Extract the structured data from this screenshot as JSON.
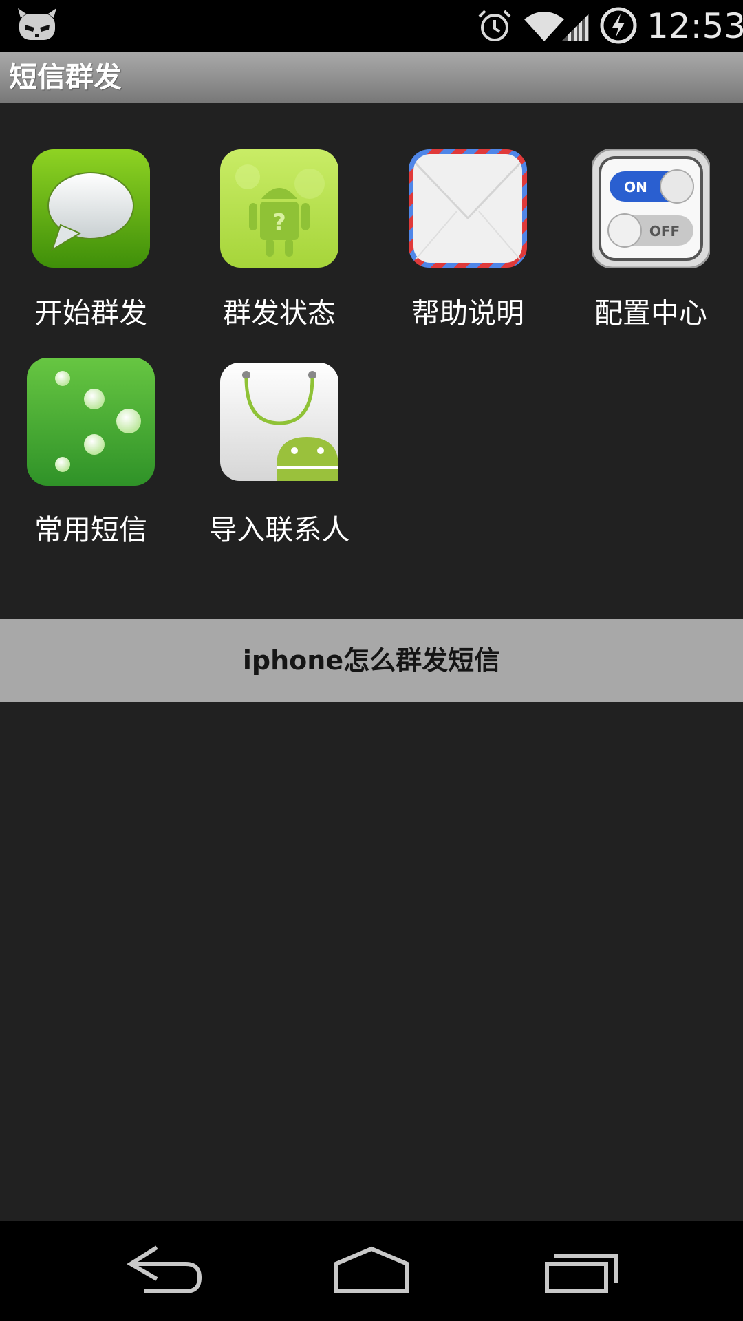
{
  "status_bar": {
    "time": "12:53",
    "icons": [
      "cyanogenmod-mascot-icon",
      "alarm-icon",
      "wifi-icon",
      "cell-signal-icon",
      "battery-charging-icon"
    ]
  },
  "title_bar": {
    "title": "短信群发"
  },
  "grid": {
    "items": [
      {
        "label": "开始群发",
        "icon": "speech-bubble-icon"
      },
      {
        "label": "群发状态",
        "icon": "android-question-icon"
      },
      {
        "label": "帮助说明",
        "icon": "envelope-icon"
      },
      {
        "label": "配置中心",
        "icon": "on-off-toggle-icon"
      },
      {
        "label": "常用短信",
        "icon": "dots-icon"
      },
      {
        "label": "导入联系人",
        "icon": "android-shopping-bag-icon"
      }
    ]
  },
  "banner": {
    "text": "iphone怎么群发短信"
  },
  "nav_bar": {
    "icons": [
      "back-icon",
      "home-icon",
      "recent-apps-icon"
    ]
  },
  "colors": {
    "background": "#212121",
    "title_bar": "#8f8f8f",
    "banner": "#a8a8a8",
    "icon_green": "#6ab816",
    "toggle_blue": "#2a5fd0"
  }
}
